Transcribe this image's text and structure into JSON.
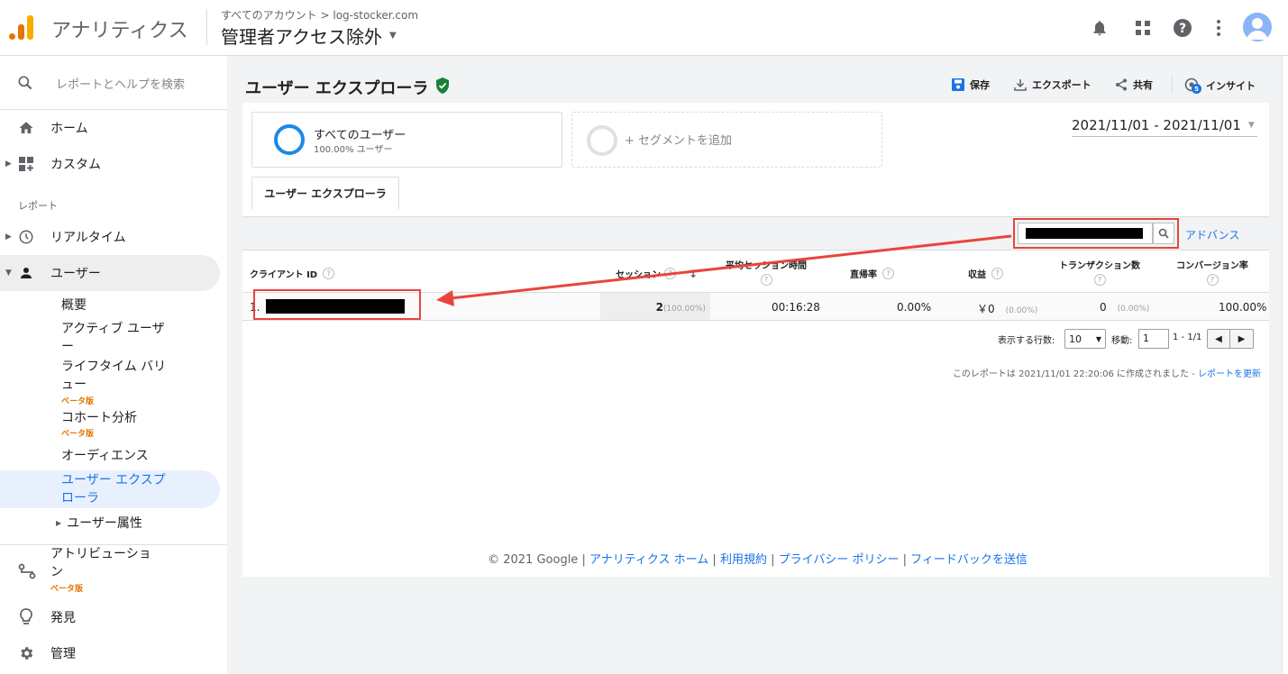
{
  "header": {
    "app_name": "アナリティクス",
    "breadcrumb": "すべてのアカウント > log-stocker.com",
    "view_name": "管理者アクセス除外"
  },
  "sidebar": {
    "search_placeholder": "レポートとヘルプを検索",
    "home": "ホーム",
    "custom": "カスタム",
    "section_reports": "レポート",
    "realtime": "リアルタイム",
    "users": "ユーザー",
    "sub": {
      "overview": "概要",
      "active_users_1": "アクティブ ユーザ",
      "active_users_2": "ー",
      "ltv_1": "ライフタイム バリ",
      "ltv_2": "ュー",
      "beta": "ベータ版",
      "cohort": "コホート分析",
      "audience": "オーディエンス",
      "explorer_1": "ユーザー エクスプ",
      "explorer_2": "ローラ",
      "attributes": "ユーザー属性"
    },
    "attribution_1": "アトリビューショ",
    "attribution_2": "ン",
    "discover": "発見",
    "admin": "管理"
  },
  "main": {
    "title": "ユーザー エクスプローラ",
    "toolbar": {
      "save": "保存",
      "export": "エクスポート",
      "share": "共有",
      "insight": "インサイト",
      "insight_badge": "5"
    },
    "segment": {
      "name": "すべてのユーザー",
      "share": "100.00% ユーザー",
      "add": "+ セグメントを追加"
    },
    "date_range": "2021/11/01 - 2021/11/01",
    "tab": "ユーザー エクスプローラ",
    "advanced": "アドバンス",
    "table": {
      "headers": {
        "client_id": "クライアント ID",
        "sessions": "セッション",
        "avg_duration": "平均セッション時間",
        "bounce": "直帰率",
        "revenue": "収益",
        "transactions": "トランザクション数",
        "conversion": "コンバージョン率"
      },
      "row": {
        "index": "1.",
        "sessions": "2",
        "sessions_pct": "(100.00%)",
        "avg_duration": "00:16:28",
        "bounce": "0.00%",
        "revenue": "￥0",
        "revenue_pct": "(0.00%)",
        "transactions": "0",
        "transactions_pct": "(0.00%)",
        "conversion": "100.00%"
      }
    },
    "pagination": {
      "rows_label": "表示する行数:",
      "rows_value": "10",
      "goto_label": "移動:",
      "goto_value": "1",
      "range": "1 - 1/1"
    },
    "report_note": "このレポートは 2021/11/01 22:20:06 に作成されました -",
    "refresh": "レポートを更新",
    "footer": {
      "copyright": "© 2021 Google",
      "home": "アナリティクス ホーム",
      "terms": "利用規約",
      "privacy": "プライバシー ポリシー",
      "feedback": "フィードバックを送信"
    }
  },
  "colors": {
    "accent": "#1a73e8",
    "highlight": "#e8f0fe",
    "annotation": "#e8453c",
    "beta": "#e37400"
  }
}
